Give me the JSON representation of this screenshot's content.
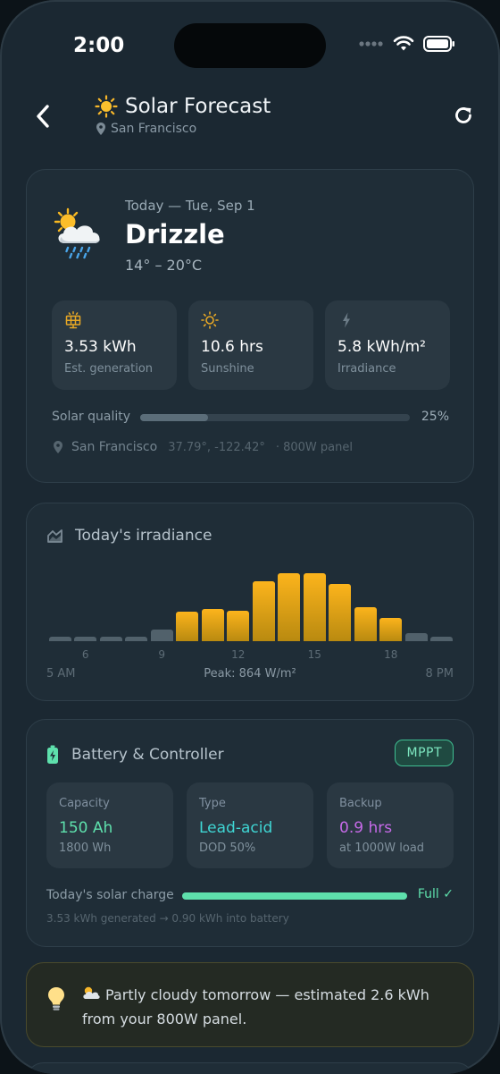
{
  "status_bar": {
    "time": "2:00",
    "icons": [
      "signal-dots-icon",
      "wifi-icon",
      "battery-icon"
    ]
  },
  "header": {
    "title": "Solar Forecast",
    "title_icon": "sun-icon",
    "location": "San Francisco",
    "back_icon": "chevron-left-icon",
    "refresh_icon": "refresh-icon"
  },
  "today": {
    "date": "Today — Tue, Sep 1",
    "condition": "Drizzle",
    "temp_range": "14° – 20°C",
    "weather_icon": "sun-behind-rain-cloud-icon",
    "metrics": [
      {
        "icon": "solar-panel-icon",
        "value": "3.53 kWh",
        "label": "Est. generation"
      },
      {
        "icon": "sun-outline-icon",
        "value": "10.6 hrs",
        "label": "Sunshine"
      },
      {
        "icon": "bolt-icon",
        "value": "5.8 kWh/m²",
        "label": "Irradiance"
      }
    ],
    "quality_label": "Solar quality",
    "quality_value": 0.25,
    "quality_text": "25%",
    "location_city": "San Francisco",
    "location_coords": "37.79°, -122.42°",
    "location_panel": "· 800W panel"
  },
  "irradiance": {
    "title": "Today's irradiance",
    "icon": "area-chart-icon",
    "start_label": "5 AM",
    "end_label": "8 PM",
    "peak_label": "Peak: 864 W/m²"
  },
  "chart_data": {
    "type": "bar",
    "title": "Today's irradiance",
    "x": [
      5,
      6,
      7,
      8,
      9,
      10,
      11,
      12,
      13,
      14,
      15,
      16,
      17,
      18,
      19,
      20
    ],
    "tick_labels": [
      "6",
      "9",
      "12",
      "15",
      "18"
    ],
    "tick_positions": [
      6,
      9,
      12,
      15,
      18
    ],
    "x_start_label": "5 AM",
    "x_end_label": "8 PM",
    "values": [
      30,
      30,
      30,
      50,
      120,
      310,
      340,
      320,
      630,
      710,
      710,
      600,
      360,
      240,
      80,
      30
    ],
    "ylim": [
      0,
      864
    ],
    "unit": "W/m²",
    "peak": 864,
    "colors": {
      "low": "#51616b",
      "high_top": "#fcb41c",
      "high_bottom": "#b98a10"
    }
  },
  "battery": {
    "title": "Battery & Controller",
    "icon": "battery-charging-icon",
    "badge": "MPPT",
    "stats": [
      {
        "label": "Capacity",
        "value": "150 Ah",
        "sub": "1800 Wh",
        "color": "#5ee0ac"
      },
      {
        "label": "Type",
        "value": "Lead-acid",
        "sub": "DOD 50%",
        "color": "#3fd6d4"
      },
      {
        "label": "Backup",
        "value": "0.9 hrs",
        "sub": "at 1000W load",
        "color": "#c66ae8"
      }
    ],
    "charge_label": "Today's solar charge",
    "charge_value": 1.0,
    "charge_status": "Full ✓",
    "charge_note": "3.53 kWh generated → 0.90 kWh into battery"
  },
  "tip": {
    "icon": "lightbulb-icon",
    "cloud_icon": "sun-behind-cloud-icon",
    "text": "Partly cloudy tomorrow — estimated 2.6 kWh from your 800W panel."
  }
}
